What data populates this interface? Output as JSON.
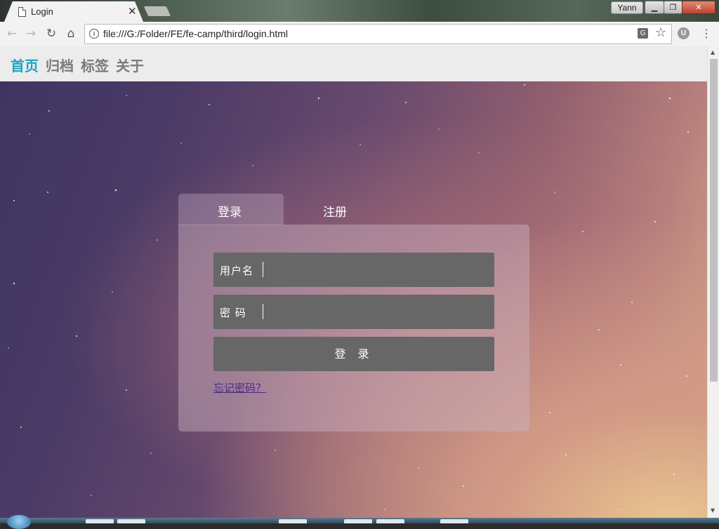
{
  "browser": {
    "tab_title": "Login",
    "tab_close": "✕",
    "profile_name": "Yann",
    "url": "file:///G:/Folder/FE/fe-camp/third/login.html",
    "icons": {
      "back": "←",
      "forward": "→",
      "reload": "↻",
      "home": "⌂",
      "info": "i",
      "translate": "G",
      "star": "☆",
      "extension": "U",
      "menu": "⋮",
      "minimize": "▁",
      "maximize": "❐",
      "close": "✕"
    }
  },
  "site_nav": {
    "items": [
      "首页",
      "归档",
      "标签",
      "关于"
    ],
    "active_index": 0,
    "active_color": "#1aa5c2"
  },
  "login": {
    "tabs": [
      "登录",
      "注册"
    ],
    "active_tab": 0,
    "username_label": "用户名",
    "password_label": "密 码",
    "submit_label": "登 录",
    "forgot_link": "忘记密码？"
  }
}
